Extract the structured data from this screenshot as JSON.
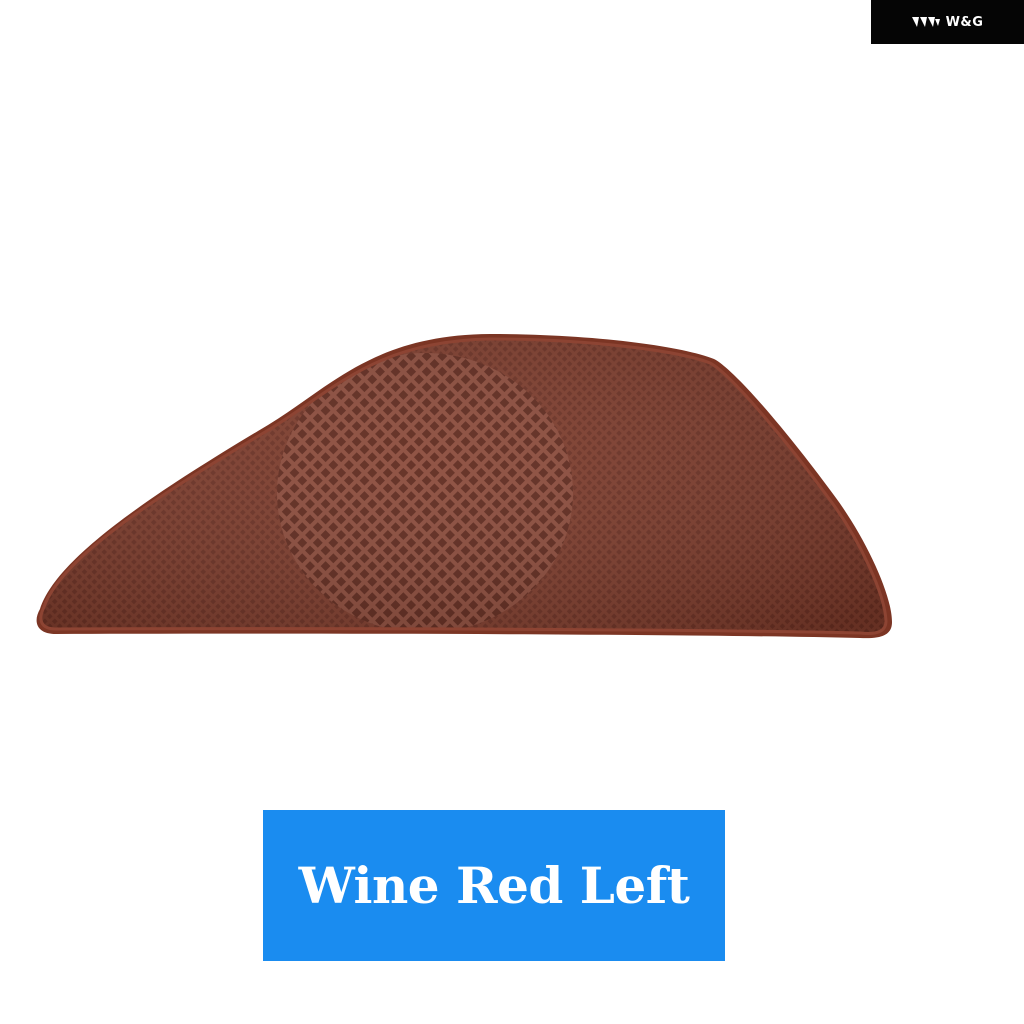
{
  "brand": {
    "name": "W&G",
    "logo_icon": "wave-logo-icon",
    "background": "#050505"
  },
  "product": {
    "subject": "speaker-grille-cover",
    "color": "#7a3a2a"
  },
  "caption": {
    "text": "Wine Red Left",
    "background": "#1a8cf0",
    "color": "#ffffff"
  }
}
